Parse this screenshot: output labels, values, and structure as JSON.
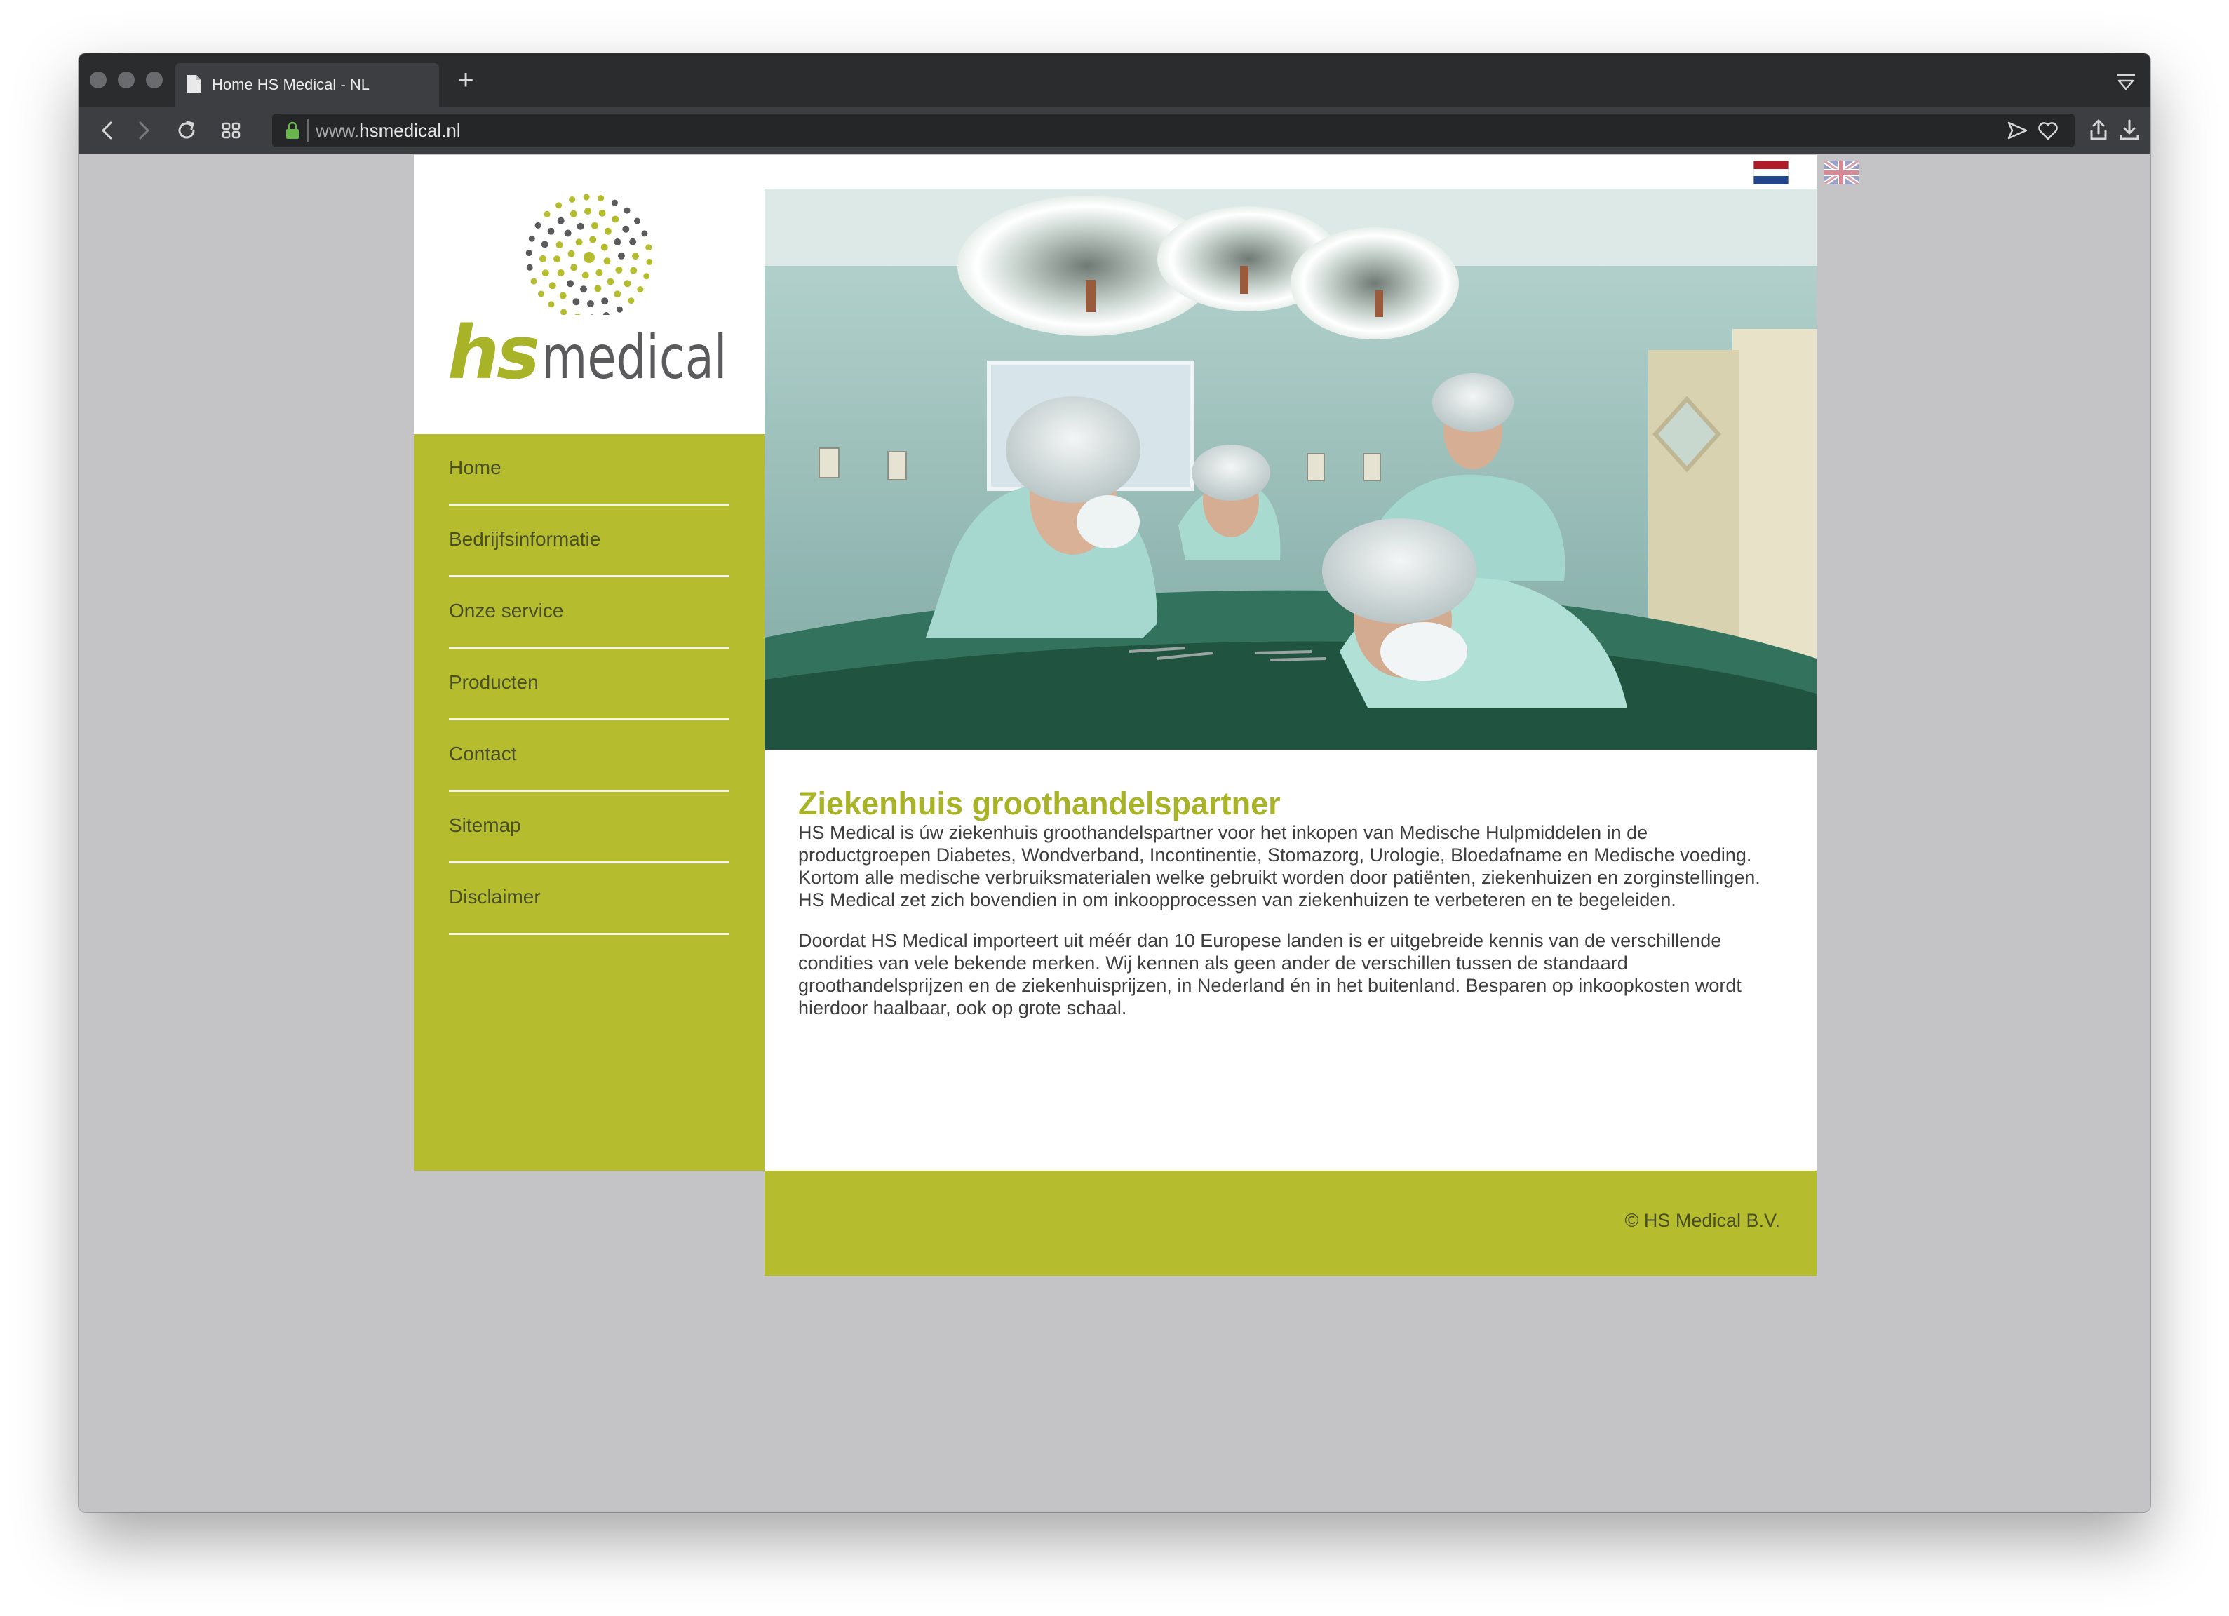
{
  "browser": {
    "tab_title": "Home HS Medical - NL",
    "url_prefix": "www.",
    "url_domain": "hsmedical.nl"
  },
  "site": {
    "logo_word_hs": "hs",
    "logo_word_medical": "medical",
    "languages": [
      "NL",
      "EN"
    ],
    "nav": [
      {
        "label": "Home"
      },
      {
        "label": "Bedrijfsinformatie"
      },
      {
        "label": "Onze service"
      },
      {
        "label": "Producten"
      },
      {
        "label": "Contact"
      },
      {
        "label": "Sitemap"
      },
      {
        "label": "Disclaimer"
      }
    ],
    "heading": "Ziekenhuis groothandelspartner",
    "paragraph1": "HS Medical is úw ziekenhuis groothandelspartner voor het inkopen van Medische Hulpmiddelen in de productgroepen Diabetes, Wondverband, Incontinentie, Stomazorg, Urologie, Bloedafname en Medische voeding. Kortom alle medische verbruiksmaterialen welke gebruikt worden door patiënten, ziekenhuizen en zorginstellingen. HS Medical zet zich bovendien in om inkoopprocessen van ziekenhuizen te verbeteren en te begeleiden.",
    "paragraph2": "Doordat HS Medical importeert uit méér dan 10 Europese landen is er uitgebreide kennis van de verschillende condities van vele bekende merken. Wij kennen als geen ander de verschillen tussen de standaard groothandelsprijzen en de ziekenhuisprijzen, in Nederland én in het buitenland. Besparen op inkoopkosten wordt hierdoor haalbaar, ook op grote schaal.",
    "footer": "© HS Medical B.V."
  },
  "colors": {
    "brand_green": "#b5bd2f",
    "heading_green": "#a9b327",
    "page_gray": "#c4c4c6",
    "logo_gray": "#5b5a5c"
  }
}
